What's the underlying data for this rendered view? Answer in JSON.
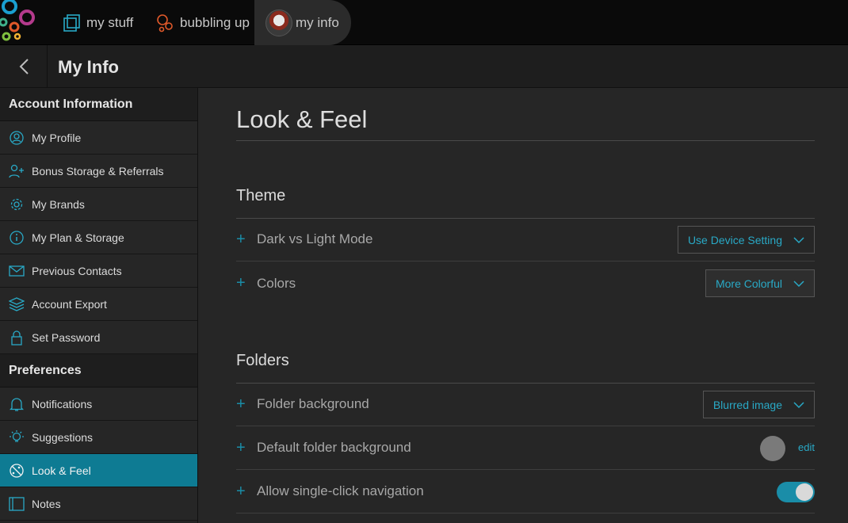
{
  "nav": {
    "tabs": [
      {
        "label": "my stuff"
      },
      {
        "label": "bubbling up"
      },
      {
        "label": "my info"
      }
    ]
  },
  "header": {
    "title": "My Info"
  },
  "sidebar": {
    "sections": [
      {
        "title": "Account Information",
        "items": [
          {
            "label": "My Profile",
            "icon": "profile-icon"
          },
          {
            "label": "Bonus Storage & Referrals",
            "icon": "add-user-icon"
          },
          {
            "label": "My Brands",
            "icon": "gear-icon"
          },
          {
            "label": "My Plan & Storage",
            "icon": "info-icon"
          },
          {
            "label": "Previous Contacts",
            "icon": "envelope-icon"
          },
          {
            "label": "Account Export",
            "icon": "layers-icon"
          },
          {
            "label": "Set Password",
            "icon": "lock-icon"
          }
        ]
      },
      {
        "title": "Preferences",
        "items": [
          {
            "label": "Notifications",
            "icon": "bell-icon"
          },
          {
            "label": "Suggestions",
            "icon": "lightbulb-icon"
          },
          {
            "label": "Look & Feel",
            "icon": "palette-icon",
            "active": true
          },
          {
            "label": "Notes",
            "icon": "note-icon"
          }
        ]
      }
    ]
  },
  "main": {
    "title": "Look & Feel",
    "theme": {
      "heading": "Theme",
      "rows": [
        {
          "label": "Dark vs Light Mode",
          "value": "Use Device Setting"
        },
        {
          "label": "Colors",
          "value": "More Colorful"
        }
      ]
    },
    "folders": {
      "heading": "Folders",
      "rows": [
        {
          "label": "Folder background",
          "value": "Blurred image"
        },
        {
          "label": "Default folder background",
          "action": "edit"
        },
        {
          "label": "Allow single-click navigation",
          "toggle_on": true
        }
      ]
    }
  },
  "colors": {
    "accent": "#16a3c4",
    "active_item": "#0e7b93",
    "background": "#262626"
  }
}
